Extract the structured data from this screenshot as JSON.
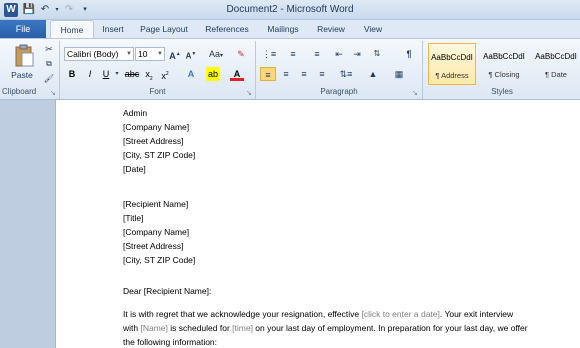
{
  "window": {
    "title": "Document2 - Microsoft Word"
  },
  "tabs": {
    "file": "File",
    "items": [
      "Home",
      "Insert",
      "Page Layout",
      "References",
      "Mailings",
      "Review",
      "View"
    ]
  },
  "clipboard": {
    "paste": "Paste",
    "label": "Clipboard"
  },
  "font": {
    "name": "Calibri (Body)",
    "size": "10",
    "label": "Font"
  },
  "paragraph": {
    "label": "Paragraph"
  },
  "styles": {
    "label": "Styles",
    "items": [
      {
        "sample": "AaBbCcDdI",
        "name": "¶ Address"
      },
      {
        "sample": "AaBbCcDdI",
        "name": "¶ Closing"
      },
      {
        "sample": "AaBbCcDdI",
        "name": "¶ Date"
      }
    ]
  },
  "document": {
    "sender": [
      "Admin",
      "[Company Name]",
      "[Street Address]",
      "[City, ST  ZIP Code]",
      "[Date]"
    ],
    "recipient": [
      "[Recipient Name]",
      "[Title]",
      "[Company Name]",
      "[Street Address]",
      "[City, ST  ZIP Code]"
    ],
    "salutation": "Dear [Recipient Name]:",
    "body": {
      "p1a": "It is with regret that we acknowledge your resignation, effective ",
      "p1ph": "[click to enter a date]",
      "p1b": ". Your exit interview",
      "p2a": "with ",
      "p2ph1": "[Name]",
      "p2b": " is scheduled for ",
      "p2ph2": "[time]",
      "p2c": " on your last day of employment. In preparation for your last day, we offer",
      "p3": "the  following  information:"
    }
  }
}
